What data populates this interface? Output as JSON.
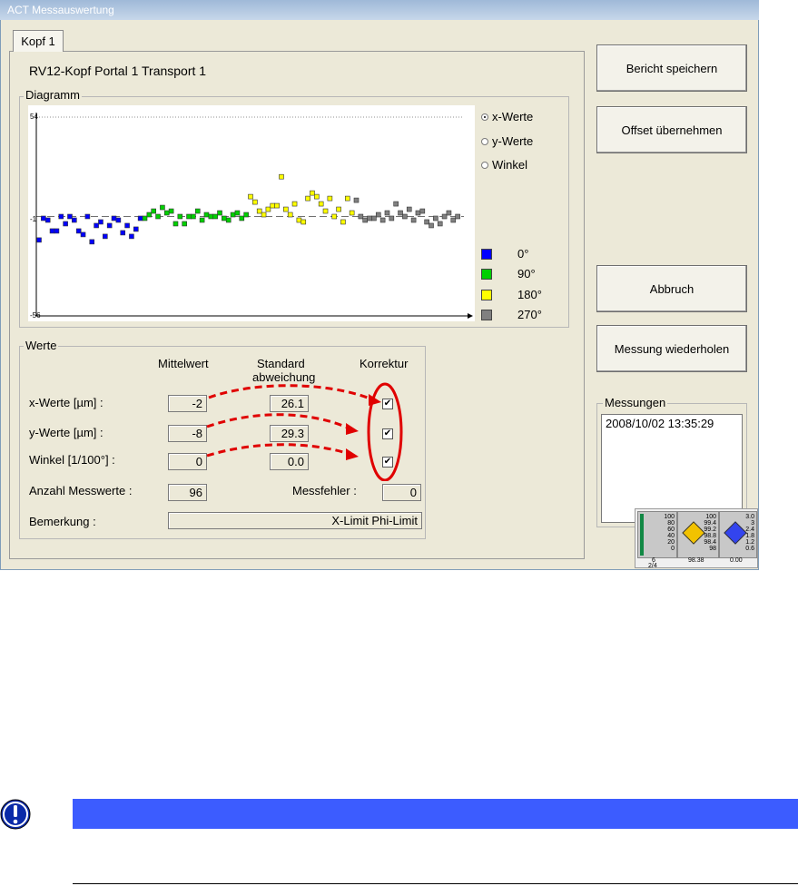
{
  "window": {
    "title": "ACT Messauswertung"
  },
  "tab": {
    "label": "Kopf 1"
  },
  "heading": "RV12-Kopf  Portal 1  Transport 1",
  "diagram": {
    "group_label": "Diagramm",
    "radio": [
      {
        "label": "x-Werte",
        "selected": true
      },
      {
        "label": "y-Werte",
        "selected": false
      },
      {
        "label": "Winkel",
        "selected": false
      }
    ],
    "legend": [
      {
        "label": "0°",
        "color": "#0000ff"
      },
      {
        "label": "90°",
        "color": "#00d000"
      },
      {
        "label": "180°",
        "color": "#ffff00"
      },
      {
        "label": "270°",
        "color": "#808080"
      }
    ]
  },
  "chart_data": {
    "type": "scatter",
    "y_ticks": [
      "54",
      "-1",
      "-56"
    ],
    "ylim": [
      -56,
      54
    ],
    "xlim": [
      0,
      96
    ],
    "reference_line": -1,
    "series": [
      {
        "name": "0°",
        "color": "#0000ff",
        "x": [
          0,
          1,
          2,
          3,
          4,
          5,
          6,
          7,
          8,
          9,
          10,
          11,
          12,
          13,
          14,
          15,
          16,
          17,
          18,
          19,
          20,
          21,
          22,
          23
        ],
        "y": [
          -14,
          -2,
          -3,
          -9,
          -9,
          -1,
          -5,
          -1,
          -3,
          -9,
          -11,
          -1,
          -15,
          -6,
          -4,
          -12,
          -6,
          -2,
          -3,
          -10,
          -6,
          -12,
          -8,
          -2
        ]
      },
      {
        "name": "90°",
        "color": "#00d000",
        "x": [
          24,
          25,
          26,
          27,
          28,
          29,
          30,
          31,
          32,
          33,
          34,
          35,
          36,
          37,
          38,
          39,
          40,
          41,
          42,
          43,
          44,
          45,
          46,
          47
        ],
        "y": [
          -2,
          0,
          2,
          -1,
          4,
          1,
          2,
          -5,
          -1,
          -5,
          -1,
          -1,
          2,
          -3,
          0,
          -1,
          -1,
          1,
          -2,
          -3,
          0,
          1,
          -2,
          0
        ]
      },
      {
        "name": "180°",
        "color": "#ffff00",
        "x": [
          48,
          49,
          50,
          51,
          52,
          53,
          54,
          55,
          56,
          57,
          58,
          59,
          60,
          61,
          62,
          63,
          64,
          65,
          66,
          67,
          68,
          69,
          70,
          71
        ],
        "y": [
          10,
          7,
          2,
          0,
          3,
          5,
          5,
          21,
          3,
          0,
          6,
          -3,
          -4,
          9,
          12,
          10,
          6,
          2,
          9,
          -1,
          3,
          -4,
          9,
          1
        ]
      },
      {
        "name": "270°",
        "color": "#808080",
        "x": [
          72,
          73,
          74,
          75,
          76,
          77,
          78,
          79,
          80,
          81,
          82,
          83,
          84,
          85,
          86,
          87,
          88,
          89,
          90,
          91,
          92,
          93,
          94,
          95
        ],
        "y": [
          8,
          -1,
          -3,
          -2,
          -2,
          0,
          -3,
          1,
          -2,
          6,
          1,
          -1,
          3,
          -3,
          1,
          2,
          -4,
          -6,
          -2,
          -5,
          -1,
          1,
          -3,
          -1
        ]
      }
    ]
  },
  "werte": {
    "group_label": "Werte",
    "col_mittelwert": "Mittelwert",
    "col_standard_line1": "Standard",
    "col_standard_line2": "abweichung",
    "col_korrektur": "Korrektur",
    "rows": [
      {
        "label": "x-Werte [µm] :",
        "mittelwert": "-2",
        "standard": "26.1",
        "korrektur": true
      },
      {
        "label": "y-Werte [µm] :",
        "mittelwert": "-8",
        "standard": "29.3",
        "korrektur": true
      },
      {
        "label": "Winkel [1/100°] :",
        "mittelwert": "0",
        "standard": "0.0",
        "korrektur": true
      }
    ],
    "anzahl_label": "Anzahl Messwerte :",
    "anzahl_value": "96",
    "messfehler_label": "Messfehler :",
    "messfehler_value": "0",
    "bemerkung_label": "Bemerkung :",
    "bemerkung_value": "X-Limit Phi-Limit",
    "annotation_color": "#e00000"
  },
  "buttons": {
    "bericht": "Bericht speichern",
    "offset": "Offset übernehmen",
    "abbruch": "Abbruch",
    "wiederholen": "Messung wiederholen"
  },
  "messungen": {
    "group_label": "Messungen",
    "items": [
      "2008/10/02  13:35:29"
    ]
  },
  "status_widget": {
    "panel1_value": "6",
    "panel1_sub": "2/4",
    "panel2_value": "98.38",
    "panel3_value": "0.00",
    "scale1": [
      "100",
      "80",
      "60",
      "40",
      "20",
      "0"
    ],
    "scale2": [
      "100",
      "99.4",
      "99.2",
      "98.8",
      "98.4",
      "98"
    ],
    "scale3": [
      "3.0",
      "3",
      "2.4",
      "1.8",
      "1.2",
      "0.6"
    ]
  }
}
